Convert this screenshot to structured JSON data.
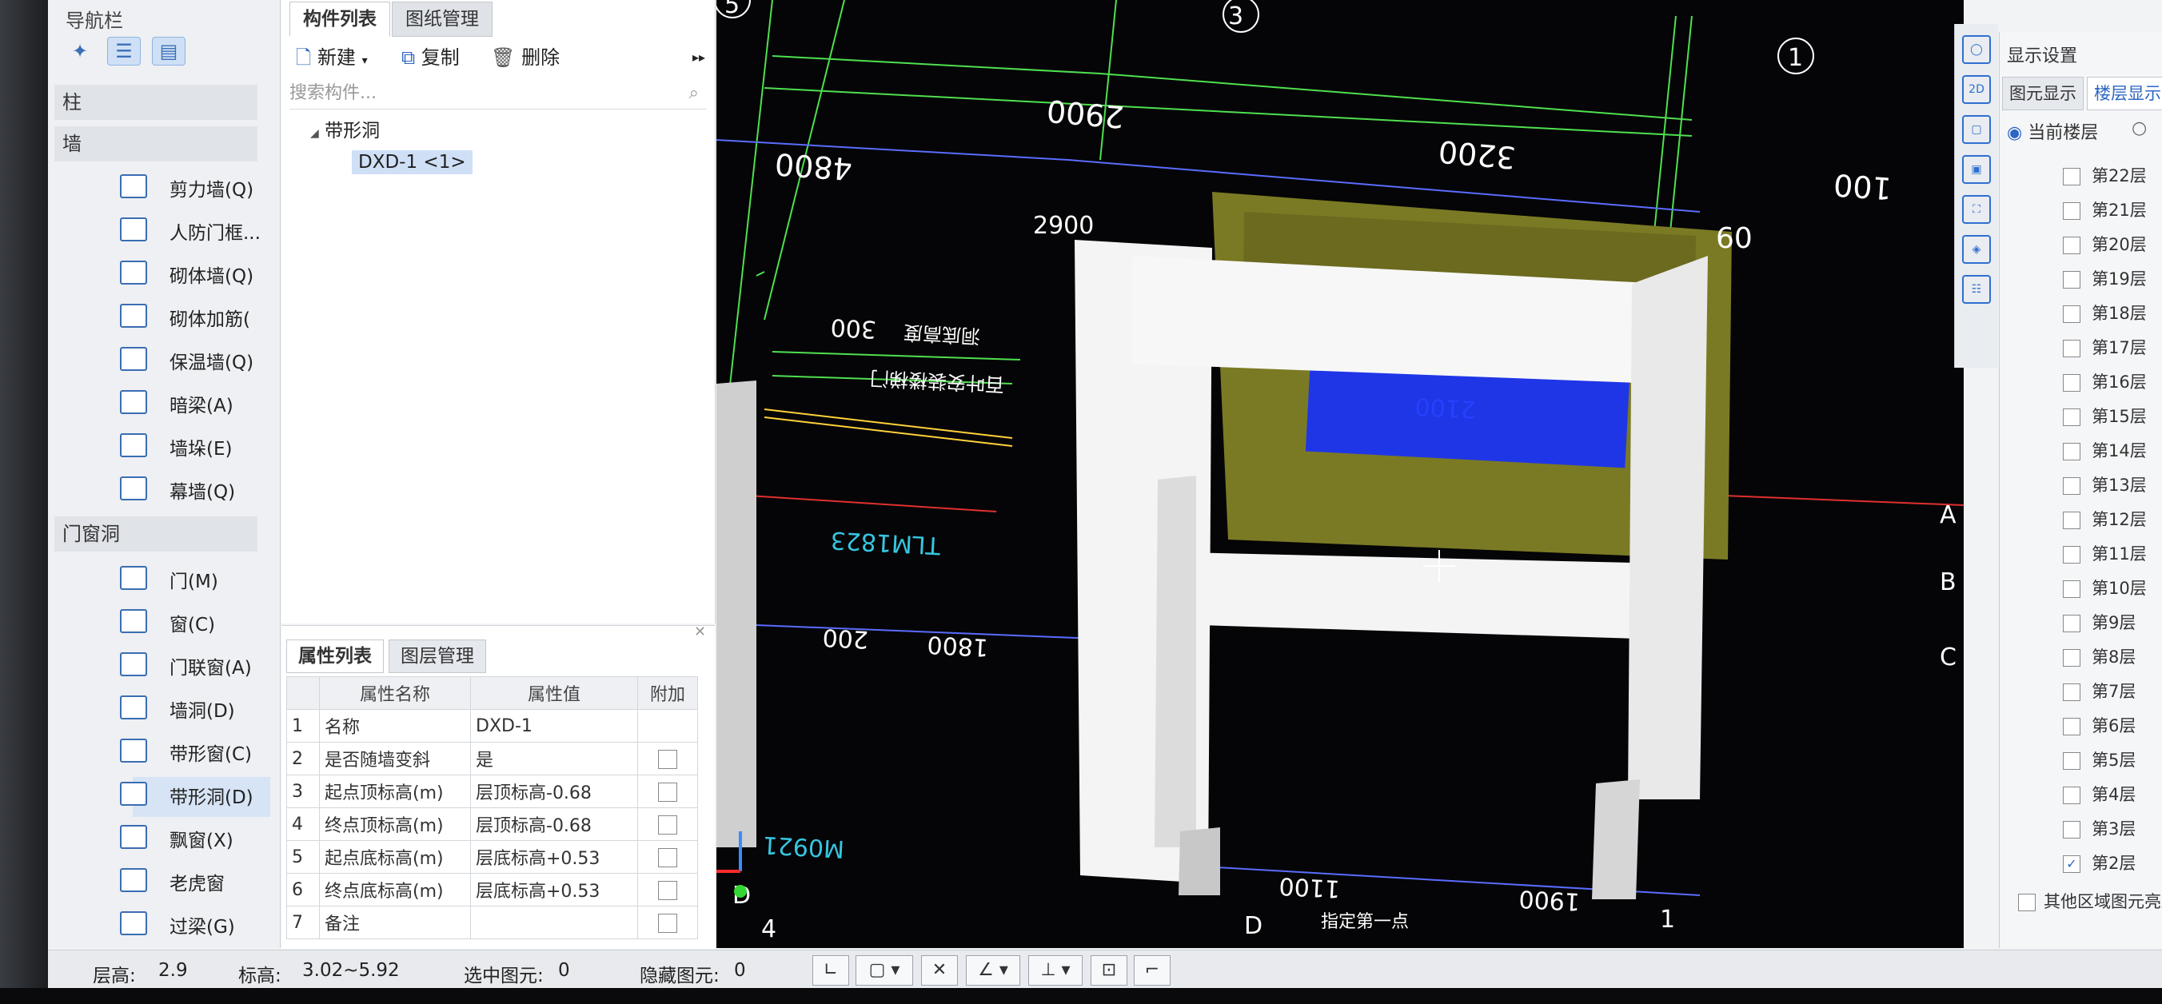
{
  "nav": {
    "title": "导航栏",
    "categories": [
      "柱",
      "墙",
      "门窗洞"
    ],
    "wall_items": [
      "剪力墙(Q)",
      "人防门框...",
      "砌体墙(Q)",
      "砌体加筋(",
      "保温墙(Q)",
      "暗梁(A)",
      "墙垛(E)",
      "幕墙(Q)"
    ],
    "opening_items": [
      "门(M)",
      "窗(C)",
      "门联窗(A)",
      "墙洞(D)",
      "带形窗(C)",
      "带形洞(D)",
      "飘窗(X)",
      "老虎窗",
      "过梁(G)"
    ]
  },
  "component_list": {
    "tabs": [
      "构件列表",
      "图纸管理"
    ],
    "toolbar": {
      "new": "新建",
      "copy": "复制",
      "delete": "删除"
    },
    "search_placeholder": "搜索构件...",
    "tree_group": "带形洞",
    "tree_item": "DXD-1 <1>"
  },
  "properties": {
    "tabs": [
      "属性列表",
      "图层管理"
    ],
    "headers": {
      "name": "属性名称",
      "value": "属性值",
      "extra": "附加"
    },
    "rows": [
      {
        "no": "1",
        "name": "名称",
        "value": "DXD-1"
      },
      {
        "no": "2",
        "name": "是否随墙变斜",
        "value": "是"
      },
      {
        "no": "3",
        "name": "起点顶标高(m)",
        "value": "层顶标高-0.68"
      },
      {
        "no": "4",
        "name": "终点顶标高(m)",
        "value": "层顶标高-0.68"
      },
      {
        "no": "5",
        "name": "起点底标高(m)",
        "value": "层底标高+0.53"
      },
      {
        "no": "6",
        "name": "终点底标高(m)",
        "value": "层底标高+0.53"
      },
      {
        "no": "7",
        "name": "备注",
        "value": ""
      }
    ]
  },
  "viewport": {
    "dims": {
      "d2900a": "2900",
      "d3200": "3200",
      "d4800": "4800",
      "d100": "100",
      "d2900b": "2900",
      "d300": "300",
      "d2100": "2100",
      "d200": "200",
      "d1800": "1800",
      "d1100": "1100",
      "d1900": "1900",
      "d60": "60"
    },
    "axes": {
      "a5": "5",
      "a3": "3",
      "a1": "1",
      "aA": "A",
      "aB": "B",
      "aC": "C",
      "a4": "4",
      "aD1": "D",
      "aD2": "D",
      "a1b": "1"
    },
    "labels": {
      "door": "TLM1823",
      "door2": "M0921",
      "note1": "洞底高度",
      "note2": "百叶安装楼梯门"
    },
    "prompt": "指定第一点"
  },
  "display": {
    "title": "显示设置",
    "tabs": [
      "图元显示",
      "楼层显示"
    ],
    "radio": "当前楼层",
    "floors": [
      "第22层",
      "第21层",
      "第20层",
      "第19层",
      "第18层",
      "第17层",
      "第16层",
      "第15层",
      "第14层",
      "第13层",
      "第12层",
      "第11层",
      "第10层",
      "第9层",
      "第8层",
      "第7层",
      "第6层",
      "第5层",
      "第4层",
      "第3层",
      "第2层"
    ],
    "other": "其他区域图元亮显"
  },
  "status": {
    "floor_height_label": "层高:",
    "floor_height": "2.9",
    "elev_label": "标高:",
    "elev": "3.02~5.92",
    "selected_label": "选中图元:",
    "selected": "0",
    "hidden_label": "隐藏图元:",
    "hidden": "0"
  }
}
